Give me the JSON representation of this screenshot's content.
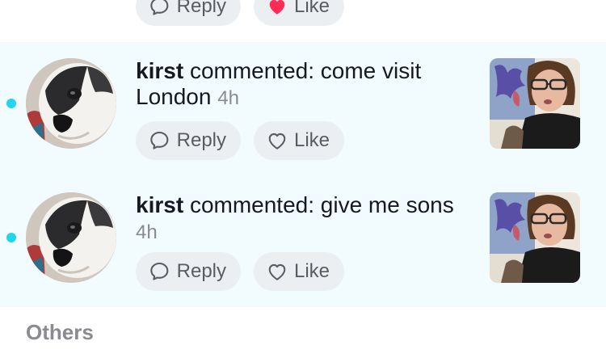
{
  "top_partial": {
    "reply_label": "Reply",
    "like_label": "Like"
  },
  "notifications": [
    {
      "username": "kirst",
      "message": "commented: come visit London",
      "time": "4h",
      "reply_label": "Reply",
      "like_label": "Like",
      "unread": true
    },
    {
      "username": "kirst",
      "message": "commented: give me sons",
      "time": "4h",
      "reply_label": "Reply",
      "like_label": "Like",
      "unread": true
    }
  ],
  "sections": {
    "others_title": "Others"
  },
  "colors": {
    "unread_dot": "#20d5ec",
    "unread_background": "#f2fbfe",
    "liked_heart": "#fe2c55",
    "button_background": "#eceff1"
  }
}
